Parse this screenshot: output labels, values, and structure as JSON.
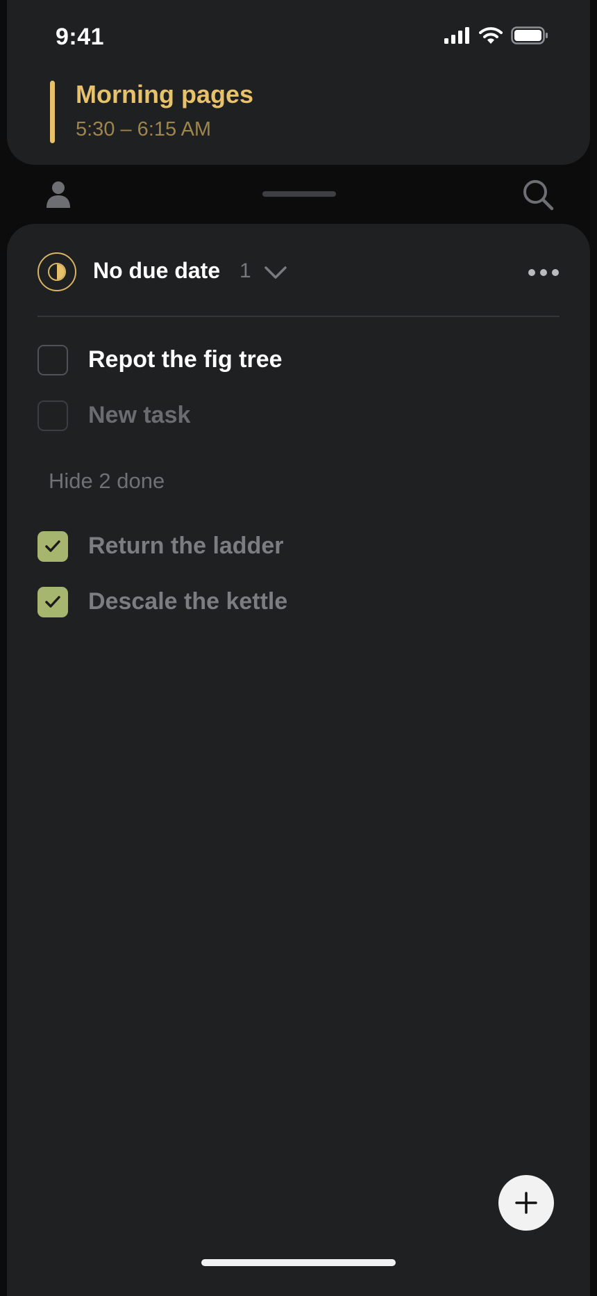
{
  "status_bar": {
    "time": "9:41",
    "icons": [
      "cellular-signal-icon",
      "wifi-icon",
      "battery-icon"
    ]
  },
  "event": {
    "title": "Morning pages",
    "time_range": "5:30 – 6:15 AM",
    "accent_color": "#e8c26a",
    "time_color": "#9e854c"
  },
  "toolbar": {
    "left_icon": "person-icon",
    "right_icon": "search-icon"
  },
  "section": {
    "title": "No due date",
    "count": "1",
    "icon": "half-circle-icon",
    "accent_color": "#d8b463"
  },
  "tasks_open": [
    {
      "label": "Repot the fig tree",
      "checked": false
    }
  ],
  "new_task": {
    "placeholder": "New task"
  },
  "hide_done_label": "Hide 2 done",
  "tasks_done": [
    {
      "label": "Return the ladder",
      "checked": true
    },
    {
      "label": "Descale the kettle",
      "checked": true
    }
  ],
  "colors": {
    "background": "#0c0c0d",
    "surface": "#1f2022",
    "check_fill": "#a6b66e",
    "fab": "#f2f2f2"
  }
}
